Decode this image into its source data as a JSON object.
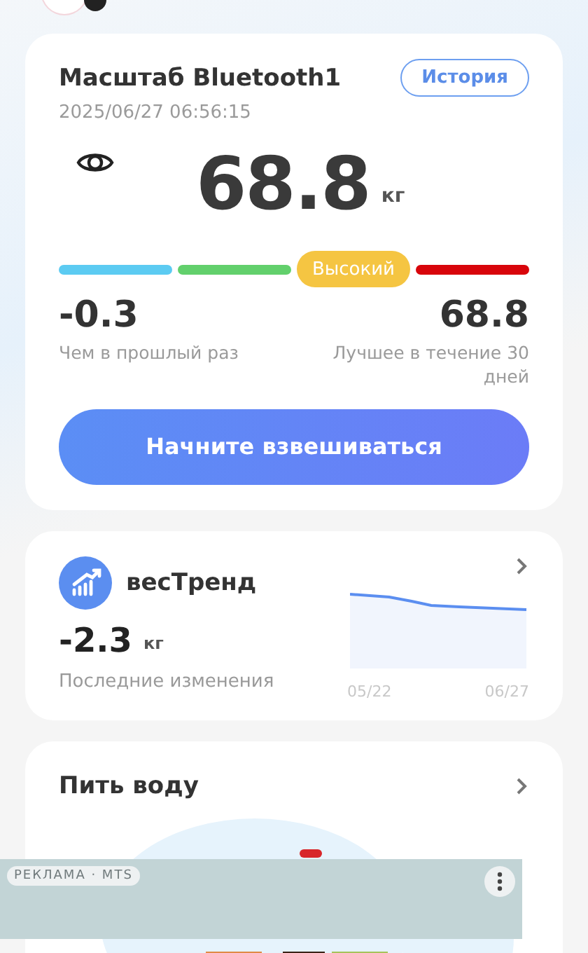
{
  "scale_card": {
    "title": "Масштаб Bluetooth1",
    "history_button": "История",
    "timestamp": "2025/06/27 06:56:15",
    "weight": "68.8",
    "unit": "кг",
    "level_label": "Высокий",
    "segments": [
      {
        "color": "#5ccbf2",
        "selected": false
      },
      {
        "color": "#62d06c",
        "selected": false
      },
      {
        "color": "#f5c542",
        "selected": true
      },
      {
        "color": "#d8050b",
        "selected": false
      }
    ],
    "stats": [
      {
        "value": "-0.3",
        "label": "Чем в прошлый раз"
      },
      {
        "value": "68.8",
        "label": "Лучшее в течение 30 дней"
      }
    ],
    "start_button": "Начните взвешиваться"
  },
  "trend_card": {
    "title": "весТренд",
    "value": "-2.3",
    "unit": "кг",
    "caption": "Последние изменения",
    "dates": [
      "05/22",
      "06/27"
    ]
  },
  "water_card": {
    "title": "Пить воду"
  },
  "ad": {
    "label": "РЕКЛАМА · MTS"
  }
}
